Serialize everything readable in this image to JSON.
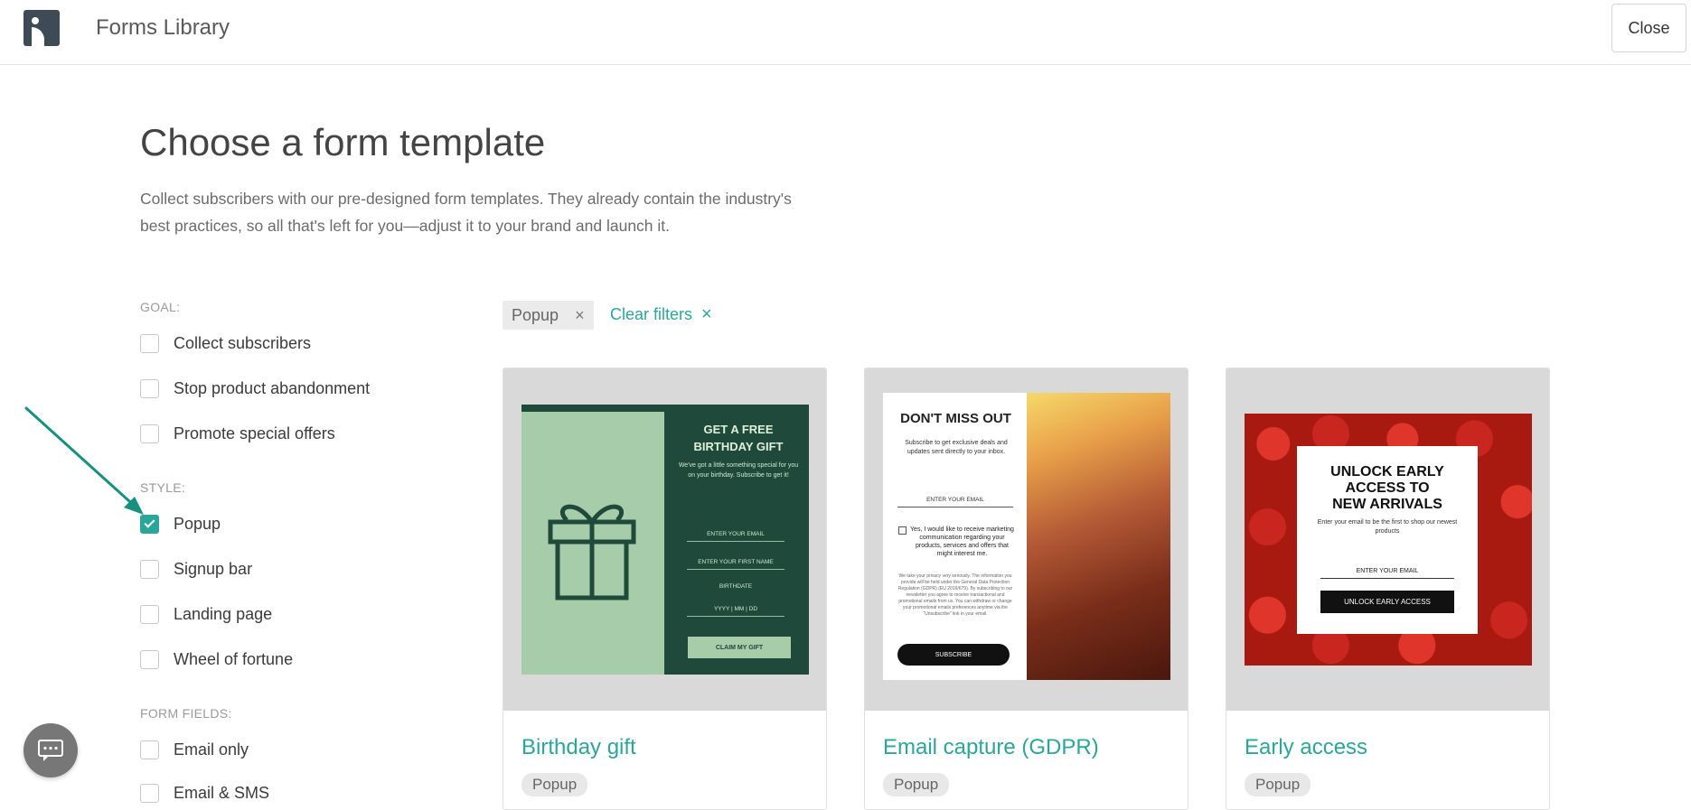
{
  "header": {
    "app_title": "Forms Library",
    "close_label": "Close"
  },
  "intro": {
    "heading": "Choose a form template",
    "description": "Collect subscribers with our pre-designed form templates. They already contain the industry's best practices, so all that's left for you—adjust it to your brand and launch it."
  },
  "filters": {
    "goal_title": "GOAL:",
    "goal_items": [
      {
        "label": "Collect subscribers",
        "checked": false
      },
      {
        "label": "Stop product abandonment",
        "checked": false
      },
      {
        "label": "Promote special offers",
        "checked": false
      }
    ],
    "style_title": "STYLE:",
    "style_items": [
      {
        "label": "Popup",
        "checked": true
      },
      {
        "label": "Signup bar",
        "checked": false
      },
      {
        "label": "Landing page",
        "checked": false
      },
      {
        "label": "Wheel of fortune",
        "checked": false
      }
    ],
    "fields_title": "FORM FIELDS:",
    "fields_items": [
      {
        "label": "Email only",
        "checked": false
      },
      {
        "label": "Email & SMS",
        "checked": false
      }
    ]
  },
  "active_filters": {
    "chip_label": "Popup",
    "chip_remove": "×",
    "clear_label": "Clear filters",
    "clear_icon": "×"
  },
  "cards": [
    {
      "title": "Birthday gift",
      "tag": "Popup",
      "preview": {
        "heading_line1": "GET A FREE",
        "heading_line2": "BIRTHDAY GIFT",
        "subtext": "We've got a little something special for you on your birthday. Subscribe to get it!",
        "field_email": "ENTER YOUR EMAIL",
        "field_name": "ENTER YOUR FIRST NAME",
        "field_birthdate": "BIRTHDATE",
        "field_date": "YYYY  |  MM  |  DD",
        "button": "CLAIM MY GIFT"
      }
    },
    {
      "title": "Email capture (GDPR)",
      "tag": "Popup",
      "preview": {
        "heading": "DON'T MISS OUT",
        "subtext": "Subscribe to get exclusive deals and updates sent directly to your inbox.",
        "field_email": "ENTER YOUR EMAIL",
        "consent": "Yes, I would like to receive marketing communication regarding your products, services and offers that might interest me.",
        "fine_print": "We take your privacy very seriously. The information you provide will be held under the General Data Protection Regulation (GDPR) (EU 2016/679). By subscribing to our newsletter you agree to receive transactional and promotional emails from us. You can withdraw or change your promotional emails preferences anytime via the \"Unsubscribe\" link in your email.",
        "button": "SUBSCRIBE"
      }
    },
    {
      "title": "Early access",
      "tag": "Popup",
      "preview": {
        "heading_line1": "UNLOCK EARLY",
        "heading_line2": "ACCESS TO",
        "heading_line3": "NEW ARRIVALS",
        "subtext": "Enter your email to be the first to shop our newest products",
        "field_email": "ENTER YOUR EMAIL",
        "button": "UNLOCK EARLY ACCESS"
      }
    }
  ],
  "colors": {
    "accent": "#2aa69a",
    "logo_bg": "#3f4a57",
    "annotation_arrow": "#16907f"
  },
  "icons": {
    "logo": "brand-logo-icon",
    "chat": "chat-bubble-icon",
    "arrow": "annotation-arrow-icon"
  }
}
